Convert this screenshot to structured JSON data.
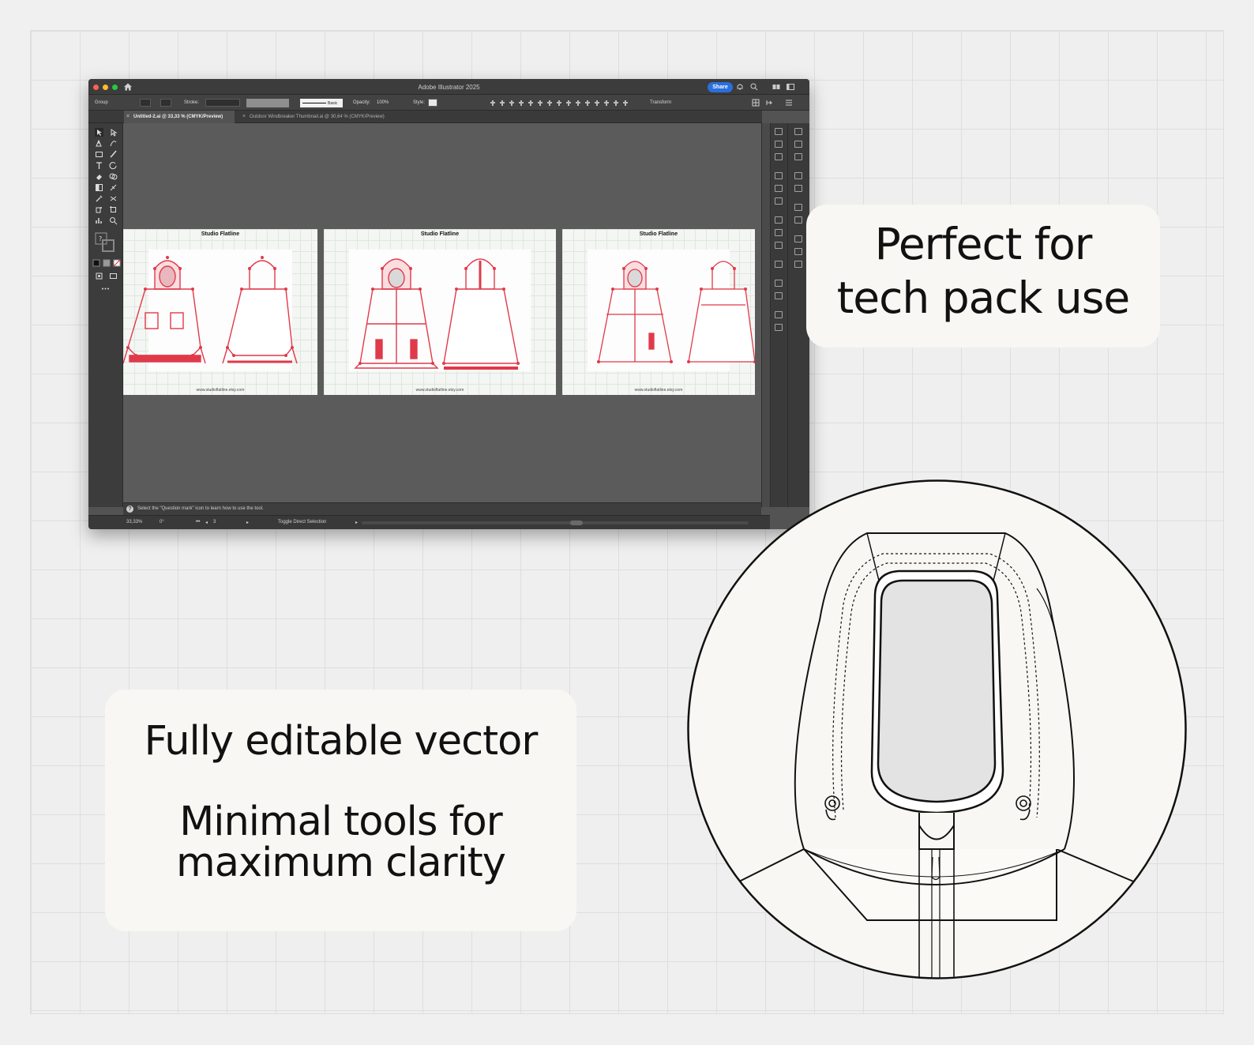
{
  "app": {
    "window_title": "Adobe Illustrator 2025",
    "share_label": "Share",
    "control": {
      "selection_label": "Group",
      "stroke_label": "Stroke:",
      "brush_label": "Basic",
      "opacity_label": "Opacity:",
      "opacity_value": "100%",
      "style_label": "Style:",
      "transform_label": "Transform"
    },
    "tabs": [
      {
        "label": "Untitled-2.ai @ 33,33 % (CMYK/Preview)",
        "active": true
      },
      {
        "label": "Outdoor Windbreaker Thumbnail.ai @ 30,64 % (CMYK/Preview)",
        "active": false
      }
    ],
    "artboards": [
      {
        "title": "Studio Flatline",
        "url": "www.studioflatline.etsy.com"
      },
      {
        "title": "Studio Flatline",
        "url": "www.studioflatline.etsy.com"
      },
      {
        "title": "Studio Flatline",
        "url": "www.studioflatline.etsy.com"
      }
    ],
    "status_hint": "Select the \"Question mark\" icon to learn how to use the tool.",
    "zoom_level": "33,33%",
    "rotation": "0°",
    "artboard_number": "3",
    "status_mode": "Toggle Direct Selection",
    "accent_color": "#e03a4a"
  },
  "callouts": {
    "tech_pack": [
      "Perfect for",
      "tech pack use"
    ],
    "vector": [
      "Fully editable vector",
      "Minimal tools for",
      "maximum clarity"
    ]
  }
}
